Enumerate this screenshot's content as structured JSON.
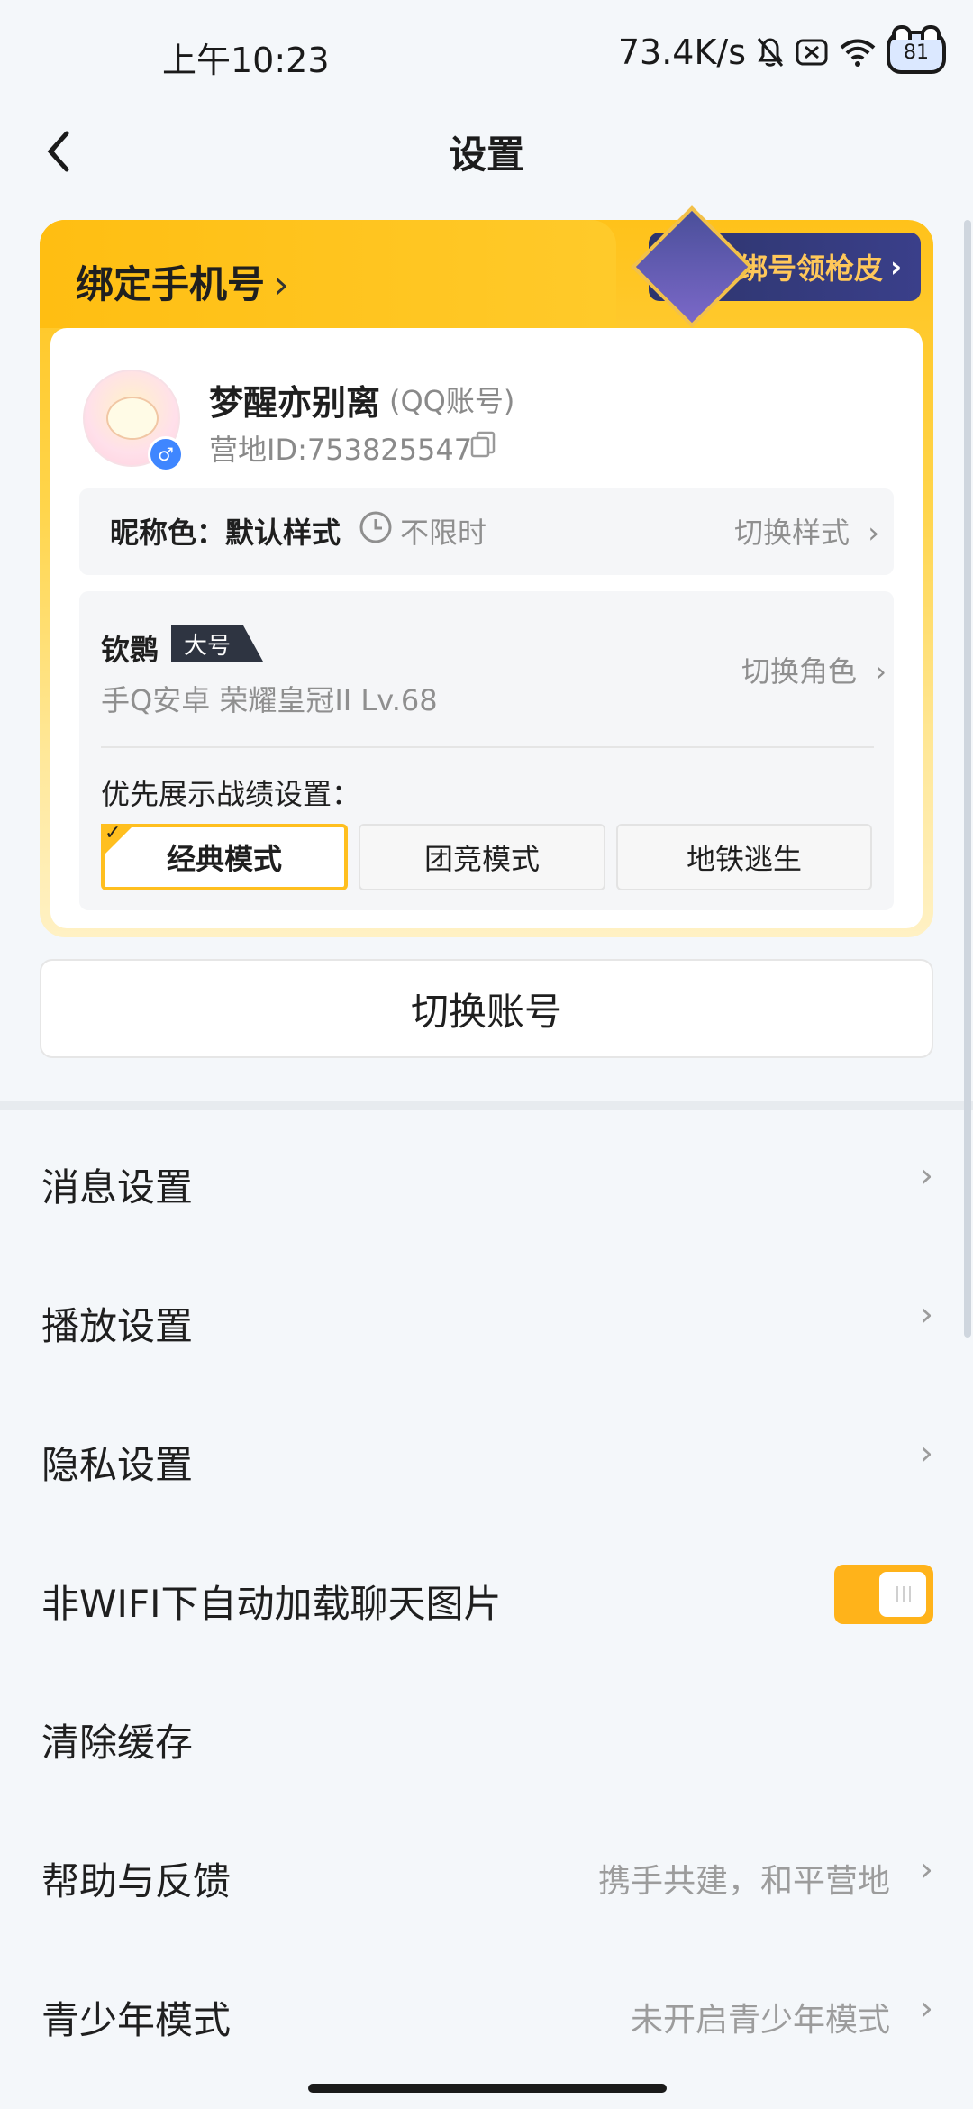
{
  "status_bar": {
    "time": "上午10:23",
    "network_speed": "73.4K/s",
    "battery": "81"
  },
  "header": {
    "title": "设置"
  },
  "account_card": {
    "bind_phone_label": "绑定手机号",
    "promo_label": "绑号领枪皮",
    "nickname": "梦醒亦别离",
    "account_type": "(QQ账号)",
    "camp_id": "营地ID:753825547",
    "nickname_color_label": "昵称色：默认样式",
    "nickname_color_duration": "不限时",
    "switch_style": "切换样式",
    "role": {
      "name": "钦鹮",
      "tag": "大号",
      "sub": "手Q安卓  荣耀皇冠II  Lv.68",
      "switch_role": "切换角色"
    },
    "record_title": "优先展示战绩设置：",
    "modes": [
      "经典模式",
      "团竞模式",
      "地铁逃生"
    ],
    "selected_mode": "经典模式"
  },
  "switch_account": "切换账号",
  "settings": [
    {
      "label": "消息设置",
      "hint": ""
    },
    {
      "label": "播放设置",
      "hint": ""
    },
    {
      "label": "隐私设置",
      "hint": ""
    },
    {
      "label": "非WIFI下自动加载聊天图片",
      "toggle": true
    },
    {
      "label": "清除缓存",
      "hint": ""
    },
    {
      "label": "帮助与反馈",
      "hint": "携手共建，和平营地"
    },
    {
      "label": "青少年模式",
      "hint": "未开启青少年模式"
    }
  ],
  "colors": {
    "accent": "#ffbf1f",
    "toggle_on": "#ffb31a"
  }
}
